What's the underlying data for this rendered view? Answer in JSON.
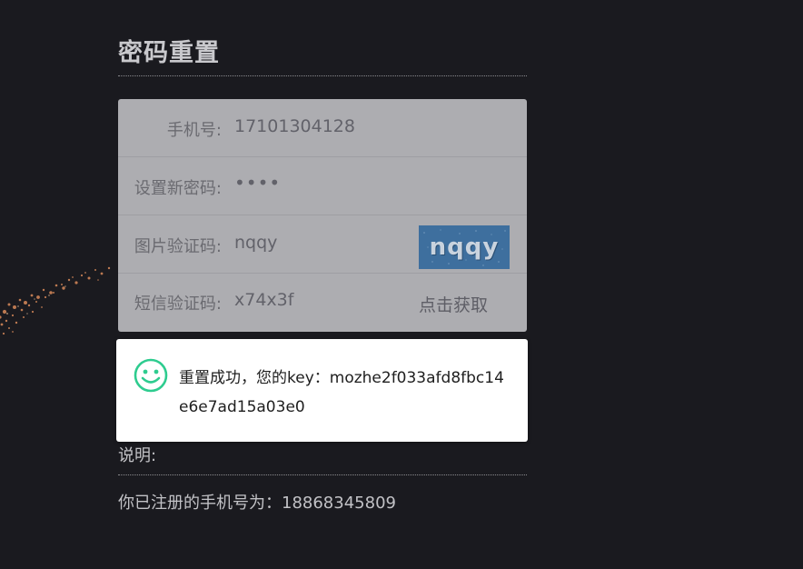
{
  "page": {
    "title": "密码重置"
  },
  "form": {
    "phone": {
      "label": "手机号:",
      "value": "17101304128"
    },
    "new_password": {
      "label": "设置新密码:",
      "value": "••••"
    },
    "captcha": {
      "label": "图片验证码:",
      "value": "nqqy",
      "image_text": "nqqy"
    },
    "sms": {
      "label": "短信验证码:",
      "value": "x74x3f",
      "button": "点击获取"
    }
  },
  "toast": {
    "icon": "smile-icon",
    "message": "重置成功，您的key：mozhe2f033afd8fbc14e6e7ad15a03e0",
    "color": "#2ecc8f"
  },
  "notes": {
    "label": "说明:",
    "text": "你已注册的手机号为：18868345809"
  }
}
